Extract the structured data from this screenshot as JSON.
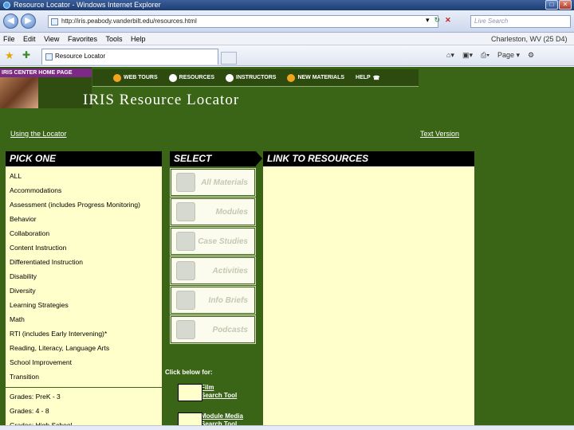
{
  "window": {
    "title": "Resource Locator - Windows Internet Explorer"
  },
  "address_bar": {
    "url": "http://iris.peabody.vanderbilt.edu/resources.html",
    "search_placeholder": "Live Search"
  },
  "menu": {
    "items": [
      "File",
      "Edit",
      "View",
      "Favorites",
      "Tools",
      "Help"
    ],
    "location_text": "Charleston, WV (25 D4)"
  },
  "tab": {
    "title": "Resource Locator"
  },
  "toolbar": {
    "page_label": "Page"
  },
  "site": {
    "home_badge": "IRIS CENTER HOME PAGE",
    "nav": [
      "WEB TOURS",
      "RESOURCES",
      "INSTRUCTORS",
      "NEW MATERIALS",
      "HELP"
    ],
    "title": "IRIS Resource Locator",
    "use_link": "Using the Locator",
    "text_version": "Text Version"
  },
  "pick_one": {
    "header": "PICK ONE",
    "topics": [
      "ALL",
      "Accommodations",
      "Assessment (includes Progress Monitoring)",
      "Behavior",
      "Collaboration",
      "Content Instruction",
      "Differentiated Instruction",
      "Disability",
      "Diversity",
      "Learning Strategies",
      "Math",
      "RTI (includes Early Intervening)*",
      "Reading, Literacy, Language Arts",
      "School Improvement",
      "Transition"
    ],
    "grades": [
      "Grades: PreK - 3",
      "Grades: 4 - 8",
      "Grades: High School"
    ]
  },
  "select": {
    "header": "SELECT",
    "materials": [
      "All Materials",
      "Modules",
      "Case Studies",
      "Activities",
      "Info Briefs",
      "Podcasts"
    ],
    "click_below": "Click below for:",
    "tools": [
      {
        "line1": "Film",
        "line2": "Search Tool"
      },
      {
        "line1": "Module Media",
        "line2": "Search Tool"
      }
    ]
  },
  "link_to_resources": {
    "header": "LINK TO RESOURCES"
  }
}
